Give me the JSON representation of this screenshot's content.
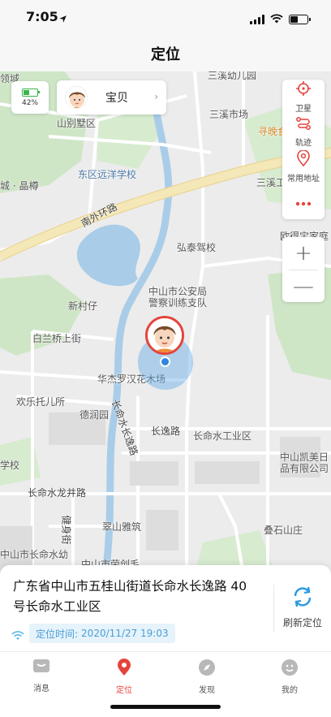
{
  "status_bar": {
    "time": "7:05"
  },
  "nav": {
    "title": "定位"
  },
  "battery_card": {
    "percent": "42%",
    "level": 0.42
  },
  "user_card": {
    "name": "宝贝"
  },
  "tools": [
    {
      "label": "卫星",
      "icon": "satellite-icon"
    },
    {
      "label": "轨迹",
      "icon": "track-icon"
    },
    {
      "label": "常用地址",
      "icon": "location-pin-icon"
    },
    {
      "label": "",
      "icon": "more-icon"
    }
  ],
  "zoom": {
    "in": "+",
    "out": "—"
  },
  "map_labels": {
    "l1": "山别墅区",
    "l2": "东区远洋学校",
    "l3": "城 · 晶樽",
    "l4": "南外环路",
    "l5": "三溪市场",
    "l6": "寻晚食",
    "l7": "三溪工",
    "l8": "弘泰驾校",
    "l9": "欧得宝家庭",
    "l10": "中山市公安局",
    "l11": "警察训练支队",
    "l12": "新村仔",
    "l13": "白兰桥上街",
    "l14": "华杰罗汉花木场",
    "l15": "欢乐托儿所",
    "l16": "德润园",
    "l17": "长逸路",
    "l18": "长命水工业区",
    "l19": "中山凯美日",
    "l20": "品有限公司",
    "l21": "学校",
    "l22": "长命水龙井路",
    "l23": "翠山雅筑",
    "l24": "叠石山庄",
    "l25": "中山市长命水幼",
    "l26": "中山市荣创毛",
    "l27": "健身街",
    "l28": "长命水长逸路",
    "l29": "三溪幼儿园",
    "l30": "领域"
  },
  "address": {
    "text": "广东省中山市五桂山街道长命水长逸路 40号长命水工业区",
    "time_label": "定位时间:",
    "time_value": "2020/11/27 19:03",
    "refresh_label": "刷新定位"
  },
  "tabs": [
    {
      "label": "消息",
      "active": false
    },
    {
      "label": "定位",
      "active": true
    },
    {
      "label": "发现",
      "active": false
    },
    {
      "label": "我的",
      "active": false
    }
  ],
  "colors": {
    "accent": "#e4443c",
    "blue": "#2d86e0",
    "battery": "#39b44a"
  }
}
